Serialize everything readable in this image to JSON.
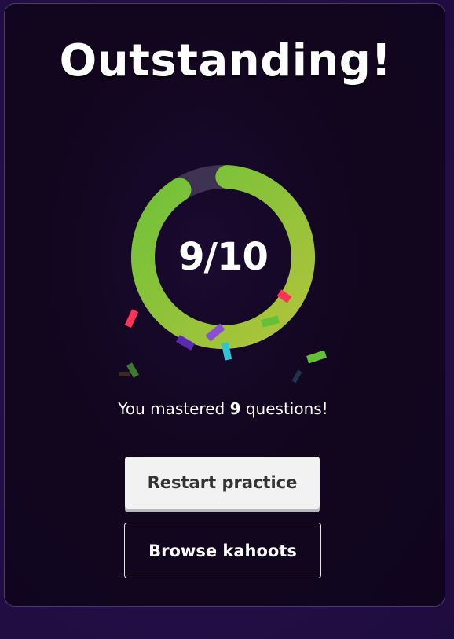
{
  "result": {
    "title": "Outstanding!",
    "score_text": "9/10",
    "correct": 9,
    "total": 10,
    "progress_fraction": 0.9,
    "summary_prefix": "You mastered ",
    "summary_count": "9",
    "summary_suffix": " questions!"
  },
  "actions": {
    "restart_label": "Restart practice",
    "browse_label": "Browse kahoots"
  },
  "colors": {
    "ring_start": "#6fc13a",
    "ring_end": "#a6c43a",
    "ring_track": "#3e3352",
    "confetti_red": "#ff3355",
    "confetti_green": "#66bf39",
    "confetti_purple": "#8a4fd4",
    "confetti_deep_purple": "#5a2bb0",
    "confetti_cyan": "#2ec6d3"
  }
}
